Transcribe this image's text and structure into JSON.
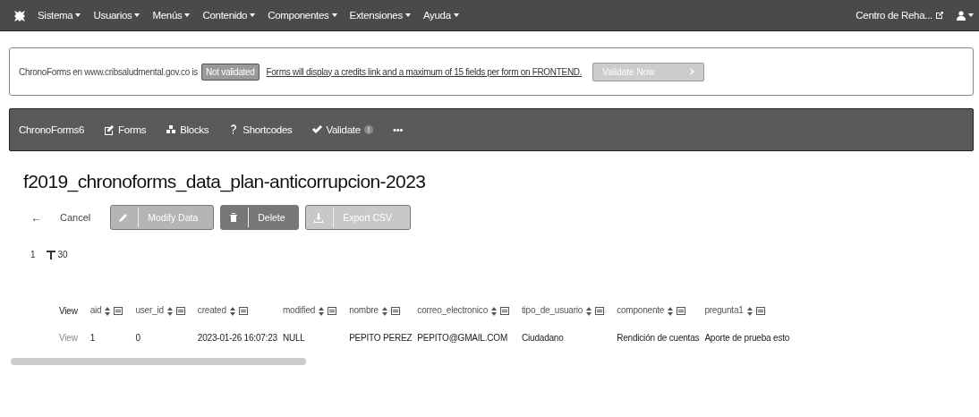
{
  "top_menu": {
    "items": [
      {
        "label": "Sistema"
      },
      {
        "label": "Usuarios"
      },
      {
        "label": "Menús"
      },
      {
        "label": "Contenido"
      },
      {
        "label": "Componentes"
      },
      {
        "label": "Extensiones"
      },
      {
        "label": "Ayuda"
      }
    ],
    "site_link": "Centro de Reha..."
  },
  "notice": {
    "text": "ChronoForms en www.cribsaludmental.gov.co is",
    "badge": "Not validated",
    "link": "Forms will display a credits link and a maximum of 15 fields per form on FRONTEND.",
    "button": "Validate Now"
  },
  "app_nav": {
    "brand": "ChronoForms6",
    "items": [
      {
        "kind": "forms",
        "label": "Forms"
      },
      {
        "kind": "blocks",
        "label": "Blocks"
      },
      {
        "kind": "shortcodes",
        "label": "Shortcodes"
      },
      {
        "kind": "validate",
        "label": "Validate",
        "badge": "!"
      },
      {
        "kind": "more",
        "label": "•••"
      }
    ]
  },
  "page_title": "f2019_chronoforms_data_plan-anticorrupcion-2023",
  "toolbar": {
    "back": "←",
    "cancel": "Cancel",
    "buttons": [
      {
        "kind": "edit",
        "label": "Modify Data"
      },
      {
        "kind": "delete",
        "label": "Delete"
      },
      {
        "kind": "export",
        "label": "Export CSV"
      }
    ]
  },
  "pagination": {
    "page": "1",
    "limit": "30"
  },
  "table": {
    "columns": [
      {
        "label": "View",
        "sortable": false
      },
      {
        "label": "aid",
        "sortable": true
      },
      {
        "label": "user_id",
        "sortable": true
      },
      {
        "label": "created",
        "sortable": true
      },
      {
        "label": "modified",
        "sortable": true
      },
      {
        "label": "nombre",
        "sortable": true
      },
      {
        "label": "correo_electronico",
        "sortable": true
      },
      {
        "label": "tipo_de_usuario",
        "sortable": true
      },
      {
        "label": "componente",
        "sortable": true
      },
      {
        "label": "pregunta1",
        "sortable": true
      }
    ],
    "rows": [
      [
        "View",
        "1",
        "0",
        "2023-01-26 16:07:23",
        "NULL",
        "PEPITO PEREZ",
        "PEPITO@GMAIL.COM",
        "Ciudadano",
        "Rendición de cuentas",
        "Aporte de prueba esto"
      ]
    ]
  }
}
